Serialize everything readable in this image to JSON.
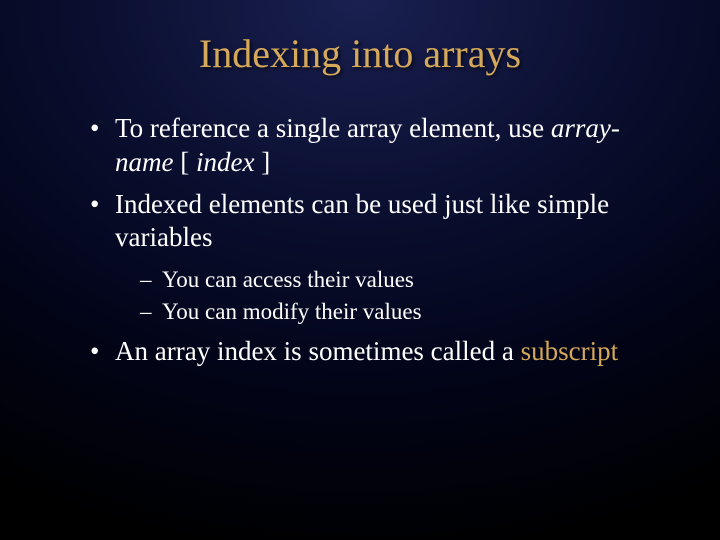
{
  "title": "Indexing into arrays",
  "bullets": {
    "b1": {
      "prefix": "To reference a single array element, use ",
      "italic1": "array-name",
      "mid1": " [ ",
      "italic2": "index",
      "mid2": " ]"
    },
    "b2": {
      "text": "Indexed elements can be used just like simple variables",
      "sub1": "You can access their values",
      "sub2": "You can modify their values"
    },
    "b3": {
      "prefix": "An array index is sometimes called a ",
      "term": "subscript"
    }
  }
}
